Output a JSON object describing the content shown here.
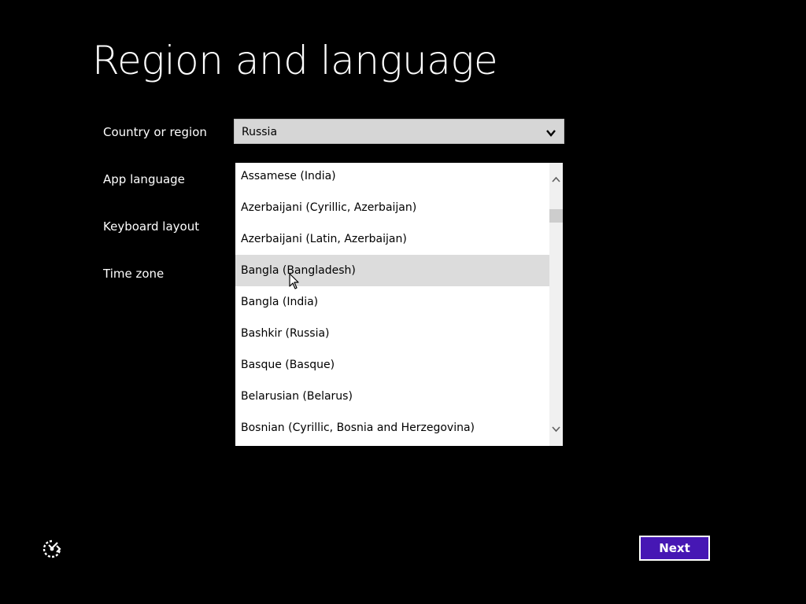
{
  "page": {
    "title": "Region and language"
  },
  "labels": {
    "country": "Country or region",
    "app_language": "App language",
    "keyboard": "Keyboard layout",
    "timezone": "Time zone"
  },
  "country_select": {
    "value": "Russia",
    "icon": "chevron-down-icon"
  },
  "app_language_dropdown": {
    "hovered_index": 3,
    "scroll_position": 0.14,
    "items": [
      "Assamese (India)",
      "Azerbaijani (Cyrillic, Azerbaijan)",
      "Azerbaijani (Latin, Azerbaijan)",
      "Bangla (Bangladesh)",
      "Bangla (India)",
      "Bashkir (Russia)",
      "Basque (Basque)",
      "Belarusian (Belarus)",
      "Bosnian (Cyrillic, Bosnia and Herzegovina)"
    ]
  },
  "footer": {
    "ease_of_access_icon": "ease-of-access-icon",
    "next_label": "Next"
  },
  "colors": {
    "background": "#000000",
    "accent": "#4617b4",
    "hover": "#dcdcdc"
  }
}
